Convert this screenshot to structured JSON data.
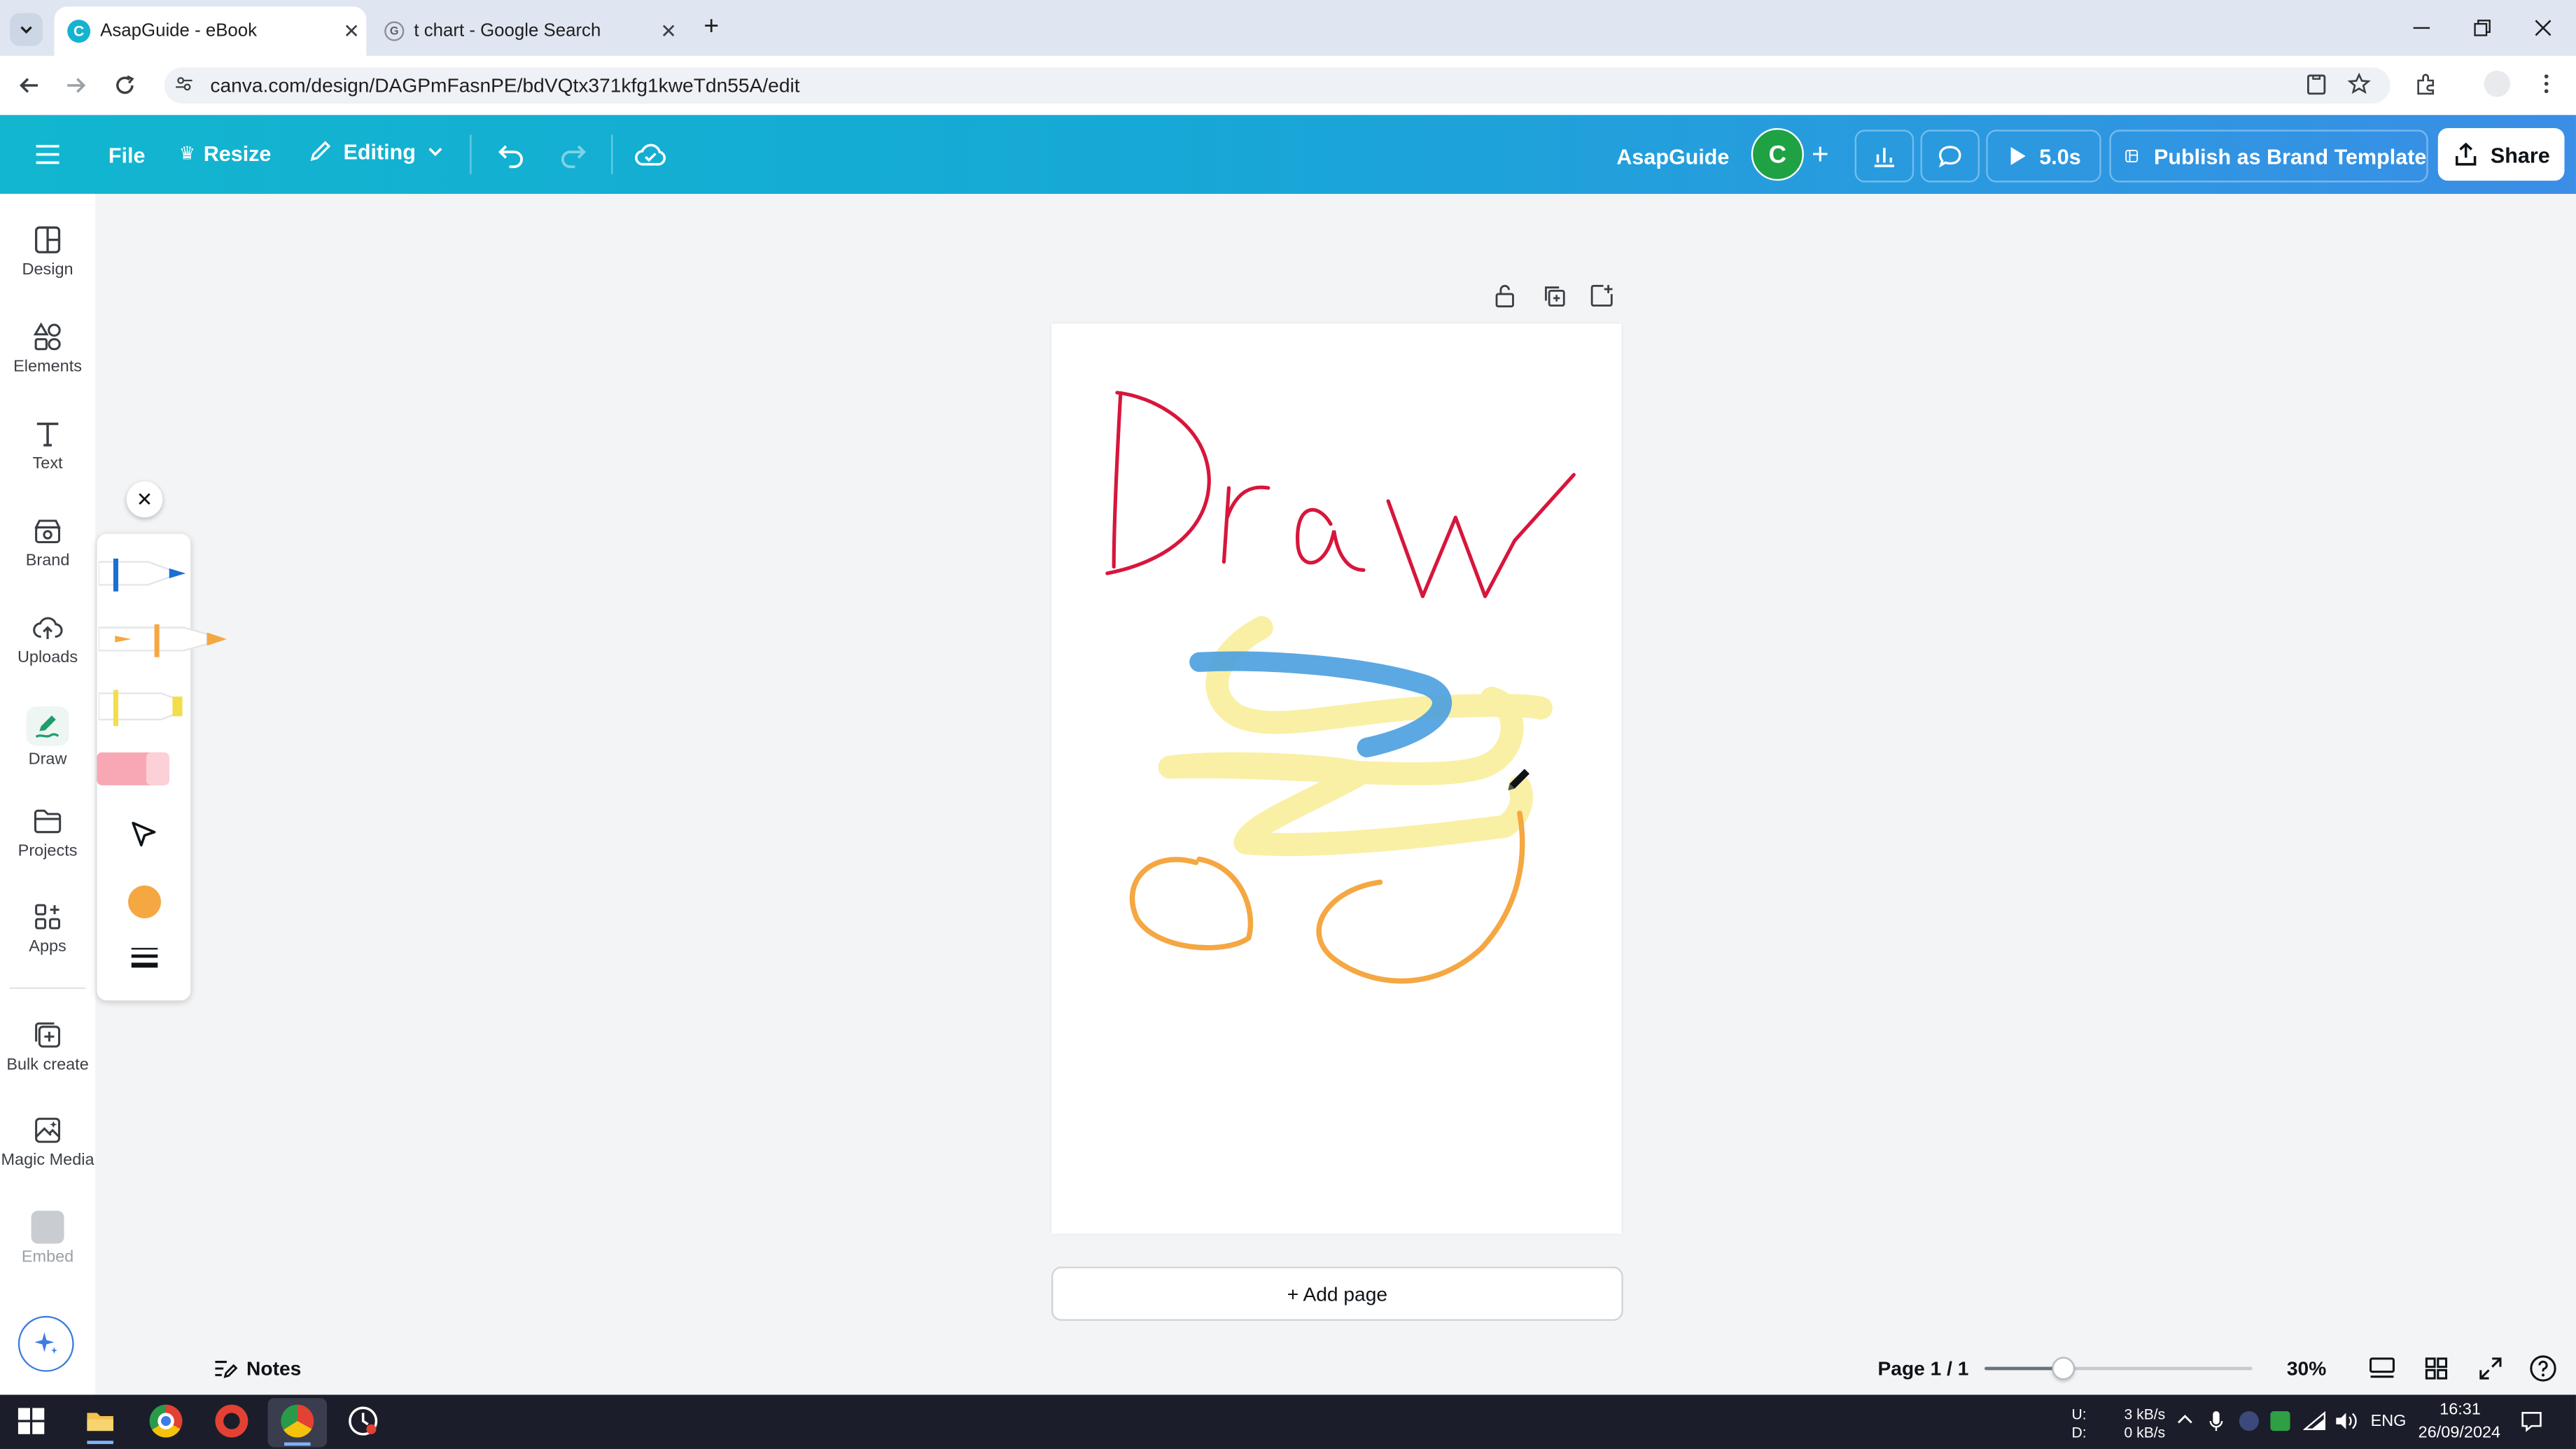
{
  "browser": {
    "tabs": [
      {
        "title": "AsapGuide - eBook",
        "active": true
      },
      {
        "title": "t chart - Google Search",
        "active": false
      }
    ],
    "url": "canva.com/design/DAGPmFasnPE/bdVQtx371kfg1kweTdn55A/edit"
  },
  "toolbar": {
    "file": "File",
    "resize": "Resize",
    "editing": "Editing",
    "project_name": "AsapGuide",
    "avatar_letter": "C",
    "timer": "5.0s",
    "publish": "Publish as Brand Template",
    "share": "Share",
    "accent": "#13b5cf"
  },
  "sidebar": {
    "items": [
      {
        "label": "Design",
        "icon": "design-icon"
      },
      {
        "label": "Elements",
        "icon": "elements-icon"
      },
      {
        "label": "Text",
        "icon": "text-icon"
      },
      {
        "label": "Brand",
        "icon": "brand-icon"
      },
      {
        "label": "Uploads",
        "icon": "uploads-icon"
      },
      {
        "label": "Draw",
        "icon": "draw-icon",
        "active": true
      },
      {
        "label": "Projects",
        "icon": "projects-icon"
      },
      {
        "label": "Apps",
        "icon": "apps-icon"
      }
    ],
    "bottom_items": [
      {
        "label": "Bulk create",
        "icon": "bulk-create-icon"
      },
      {
        "label": "Magic Media",
        "icon": "magic-media-icon"
      },
      {
        "label": "Embed",
        "icon": "embed-icon"
      }
    ]
  },
  "draw_panel": {
    "tools": [
      "pen",
      "marker",
      "highlighter",
      "eraser",
      "select"
    ],
    "selected_color": "#f5a742"
  },
  "canvas": {
    "add_page": "+ Add page"
  },
  "bottom_bar": {
    "notes": "Notes",
    "page_indicator": "Page 1 / 1",
    "zoom": "30%",
    "zoom_level": 0.3
  },
  "taskbar": {
    "upload": "U:",
    "download": "D:",
    "upload_rate": "3 kB/s",
    "download_rate": "0 kB/s",
    "language": "ENG",
    "time": "16:31",
    "date": "26/09/2024"
  }
}
